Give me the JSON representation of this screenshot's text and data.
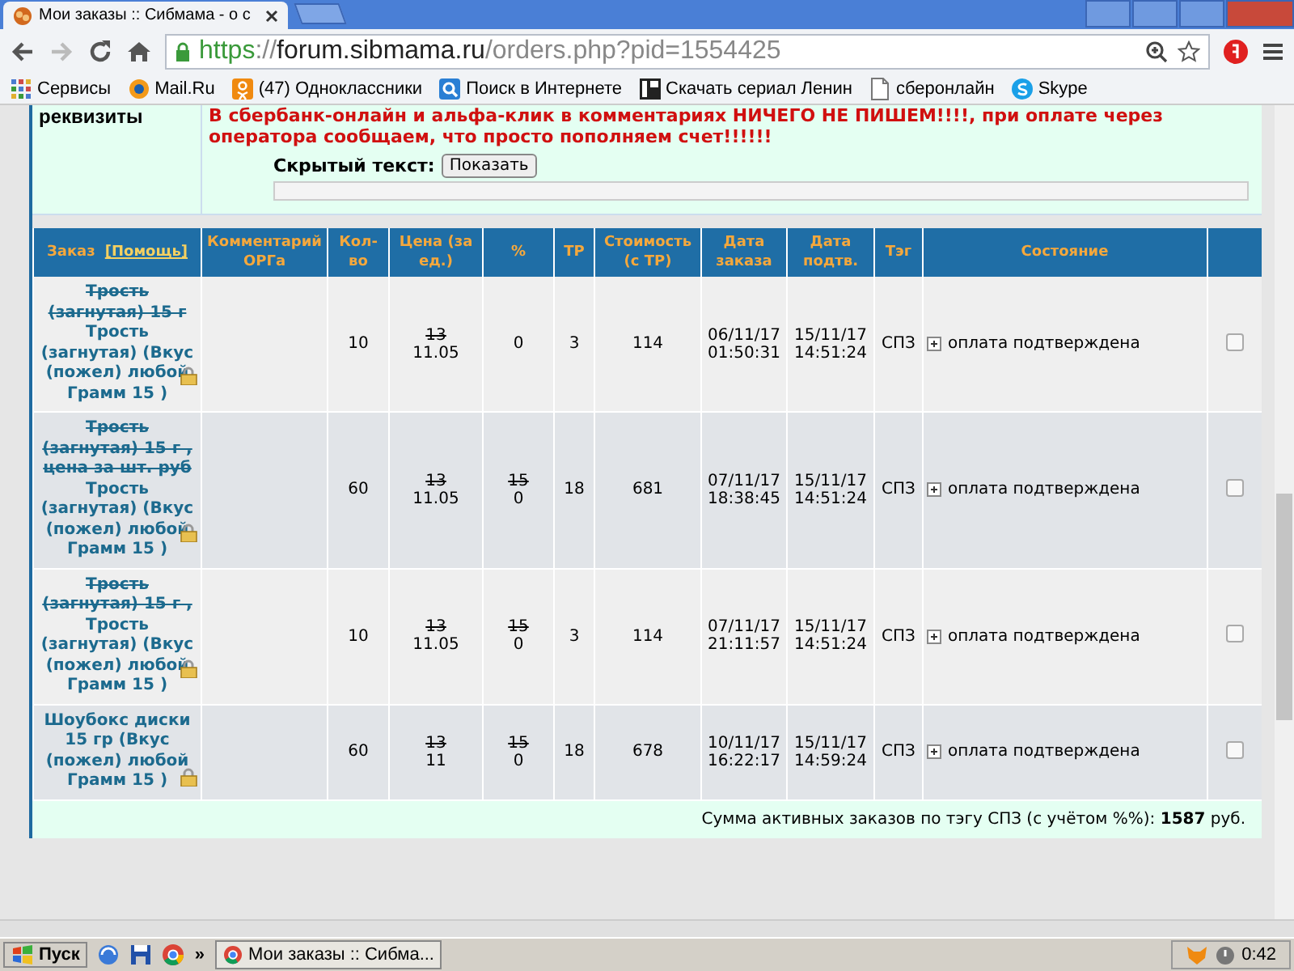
{
  "browser": {
    "tab_title": "Мои заказы :: Сибмама - о с",
    "url": {
      "scheme": "https",
      "sep": "://",
      "host": "forum.sibmama.ru",
      "path": "/orders.php?pid=1554425"
    },
    "bookmarks": [
      {
        "kind": "apps",
        "label": "Сервисы"
      },
      {
        "kind": "mail",
        "label": "Mail.Ru"
      },
      {
        "kind": "ok",
        "label": "(47) Одноклассники"
      },
      {
        "kind": "search",
        "label": "Поиск в Интернете"
      },
      {
        "kind": "film",
        "label": "Скачать сериал Ленин"
      },
      {
        "kind": "page",
        "label": "сберонлайн"
      },
      {
        "kind": "skype",
        "label": "Skype"
      }
    ]
  },
  "notice": {
    "label": "реквизиты",
    "text": "В сбербанк-онлайн и альфа-клик в комментариях НИЧЕГО НЕ ПИШЕМ!!!!, при оплате через оператора сообщаем, что просто пополняем счет!!!!!!",
    "hidden_label": "Скрытый текст:",
    "show_button": "Показать"
  },
  "table": {
    "columns": [
      {
        "label": "Заказ",
        "link": "[Помощь]"
      },
      {
        "label": "Комментарий ОРГа"
      },
      {
        "label": "Кол-во"
      },
      {
        "label": "Цена (за ед.)"
      },
      {
        "label": "%"
      },
      {
        "label": "ТР"
      },
      {
        "label": "Стоимость (с ТР)"
      },
      {
        "label": "Дата заказа"
      },
      {
        "label": "Дата подтв."
      },
      {
        "label": "Тэг"
      },
      {
        "label": "Состояние"
      }
    ],
    "rows": [
      {
        "old_name": "Трость (загнутая) 15 г",
        "name": "Трость (загнутая) (Вкус (пожел) любой Грамм 15 )",
        "qty": "10",
        "old_price": "13",
        "price": "11.05",
        "pct": "0",
        "tr": "3",
        "cost": "114",
        "ordered": "06/11/17 01:50:31",
        "confirmed": "15/11/17 14:51:24",
        "tag": "СПЗ",
        "status": "оплата подтверждена",
        "checked": false
      },
      {
        "old_name": "Трость (загнутая) 15 г , цена за шт. руб",
        "name": "Трость (загнутая) (Вкус (пожел) любой Грамм 15 )",
        "qty": "60",
        "old_price": "13",
        "price": "11.05",
        "old_pct": "15",
        "pct": "0",
        "tr": "18",
        "cost": "681",
        "ordered": "07/11/17 18:38:45",
        "confirmed": "15/11/17 14:51:24",
        "tag": "СПЗ",
        "status": "оплата подтверждена",
        "checked": false
      },
      {
        "old_name": "Трость (загнутая) 15 г ,",
        "name": "Трость (загнутая) (Вкус (пожел) любой Грамм 15 )",
        "qty": "10",
        "old_price": "13",
        "price": "11.05",
        "old_pct": "15",
        "pct": "0",
        "tr": "3",
        "cost": "114",
        "ordered": "07/11/17 21:11:57",
        "confirmed": "15/11/17 14:51:24",
        "tag": "СПЗ",
        "status": "оплата подтверждена",
        "checked": false
      },
      {
        "name": "Шоубокс диски 15 гр (Вкус (пожел) любой Грамм 15 )",
        "qty": "60",
        "old_price": "13",
        "price": "11",
        "old_pct": "15",
        "pct": "0",
        "tr": "18",
        "cost": "678",
        "ordered": "10/11/17 16:22:17",
        "confirmed": "15/11/17 14:59:24",
        "tag": "СПЗ",
        "status": "оплата подтверждена",
        "checked": false
      }
    ],
    "total": "Сумма активных заказов по тэгу СПЗ (с учётом %%): **1587** руб."
  },
  "taskbar": {
    "start": "Пуск",
    "more": "»",
    "window": "Мои заказы :: Сибма...",
    "clock": "0:42"
  }
}
